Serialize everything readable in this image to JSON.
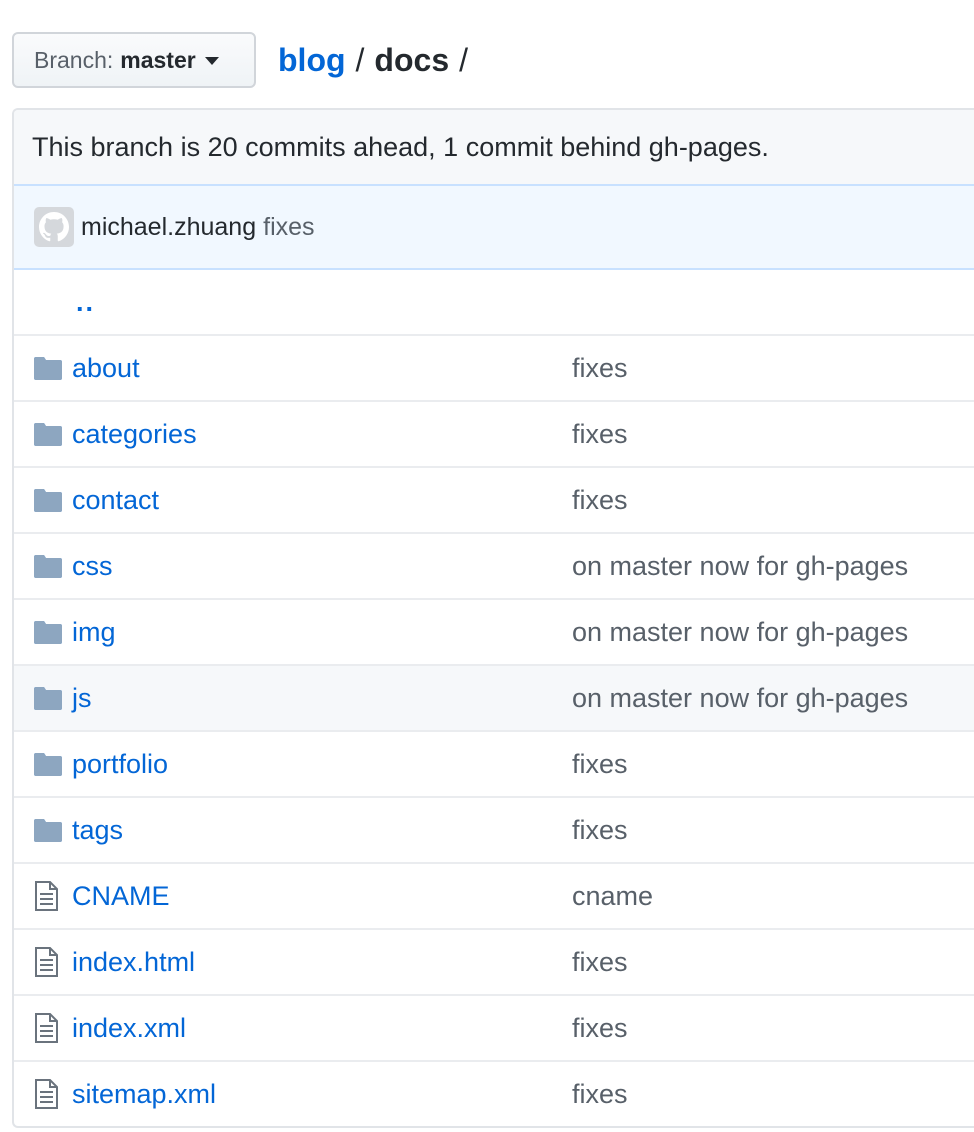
{
  "branch_selector": {
    "label": "Branch:",
    "value": "master"
  },
  "breadcrumb": {
    "repo": "blog",
    "separator": "/",
    "current": "docs",
    "trailing_separator": "/"
  },
  "branch_info": "This branch is 20 commits ahead, 1 commit behind gh-pages.",
  "latest_commit": {
    "author": "michael.zhuang",
    "message": "fixes"
  },
  "parent_link": "..",
  "files": [
    {
      "type": "folder",
      "name": "about",
      "message": "fixes"
    },
    {
      "type": "folder",
      "name": "categories",
      "message": "fixes"
    },
    {
      "type": "folder",
      "name": "contact",
      "message": "fixes"
    },
    {
      "type": "folder",
      "name": "css",
      "message": "on master now for gh-pages"
    },
    {
      "type": "folder",
      "name": "img",
      "message": "on master now for gh-pages"
    },
    {
      "type": "folder",
      "name": "js",
      "message": "on master now for gh-pages"
    },
    {
      "type": "folder",
      "name": "portfolio",
      "message": "fixes"
    },
    {
      "type": "folder",
      "name": "tags",
      "message": "fixes"
    },
    {
      "type": "file",
      "name": "CNAME",
      "message": "cname"
    },
    {
      "type": "file",
      "name": "index.html",
      "message": "fixes"
    },
    {
      "type": "file",
      "name": "index.xml",
      "message": "fixes"
    },
    {
      "type": "file",
      "name": "sitemap.xml",
      "message": "fixes"
    }
  ],
  "colors": {
    "link": "#0366d6",
    "folder_icon": "#79b8ff",
    "muted_text": "#586069",
    "border": "#e1e4e8"
  }
}
